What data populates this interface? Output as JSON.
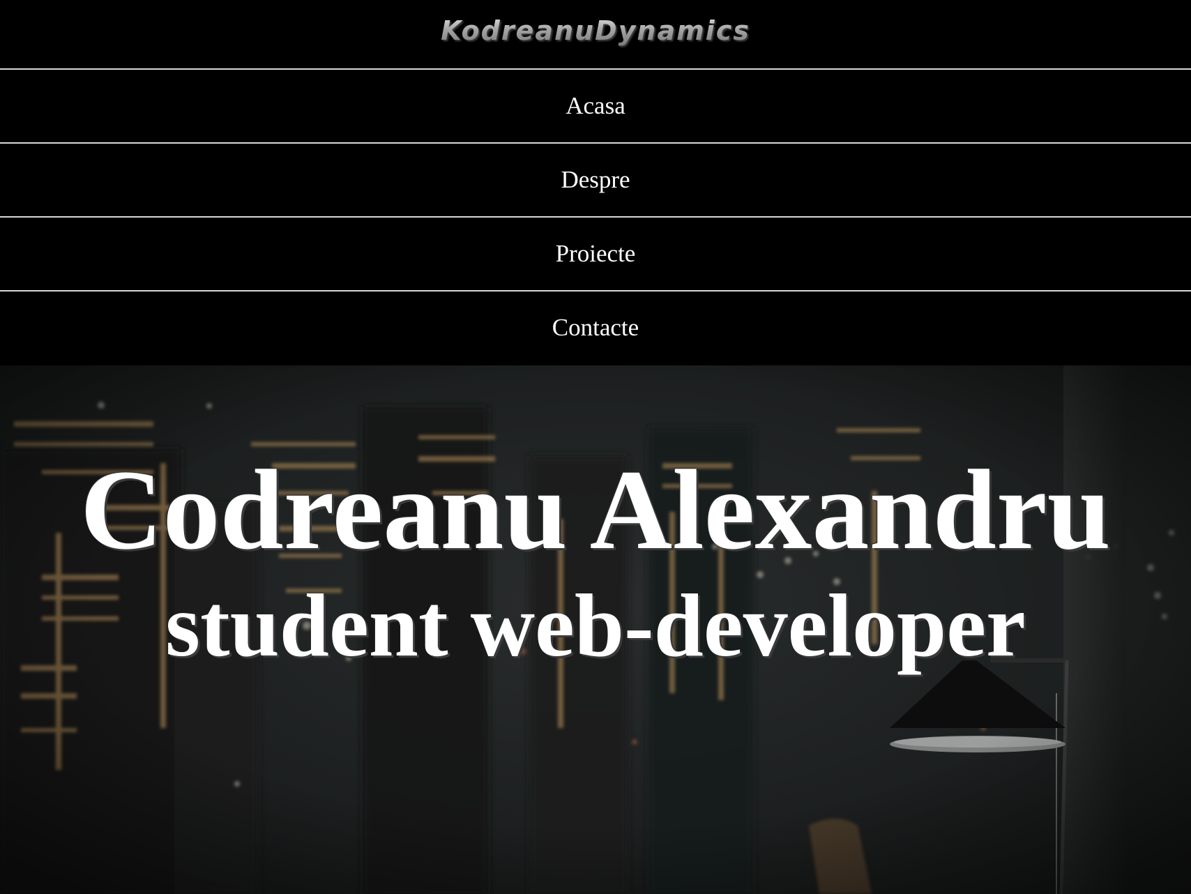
{
  "header": {
    "brand": "KodreanuDynamics"
  },
  "nav": {
    "items": [
      {
        "label": "Acasa"
      },
      {
        "label": "Despre"
      },
      {
        "label": "Proiecte"
      },
      {
        "label": "Contacte"
      }
    ]
  },
  "hero": {
    "title": "Codreanu Alexandru",
    "subtitle": "student web-developer"
  },
  "colors": {
    "background": "#000000",
    "divider": "#d8d8d8",
    "text": "#ffffff",
    "brand": "#a6a6a6",
    "hero_bg": "#1e2121",
    "city_lights": "#c8a060"
  }
}
